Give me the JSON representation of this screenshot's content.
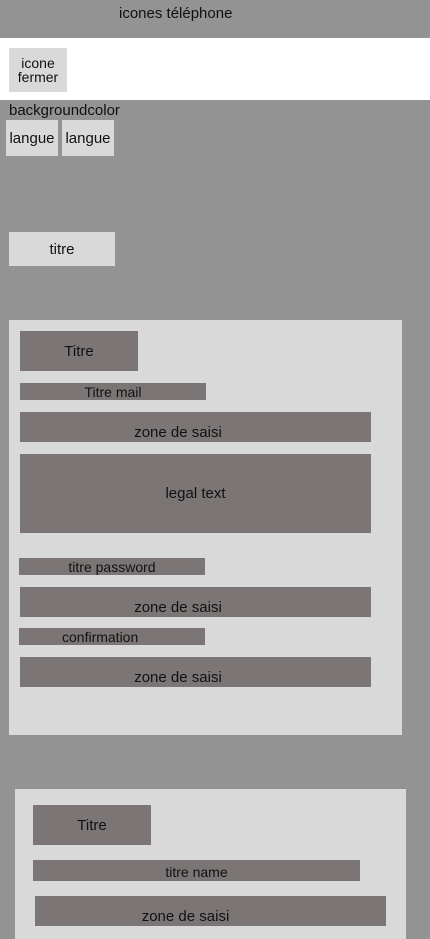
{
  "status_bar": {
    "text": "icones téléphone"
  },
  "header": {
    "close_label_line1": "icone",
    "close_label_line2": "fermer"
  },
  "background_label": "backgroundcolor",
  "languages": [
    "langue",
    "langue"
  ],
  "page_title": "titre",
  "card1": {
    "title": "Titre",
    "mail_title": "Titre mail",
    "mail_input": "zone de saisi",
    "legal_text": "legal text",
    "password_title": "titre password",
    "password_input": "zone de saisi",
    "confirmation_title": "confirmation",
    "confirmation_input": "zone de saisi"
  },
  "card2": {
    "title": "Titre",
    "name_title": "titre name",
    "name_input": "zone de saisi"
  },
  "colors": {
    "background": "#939393",
    "panel": "#d9d9d9",
    "block": "#7b7675",
    "header": "#ffffff"
  }
}
